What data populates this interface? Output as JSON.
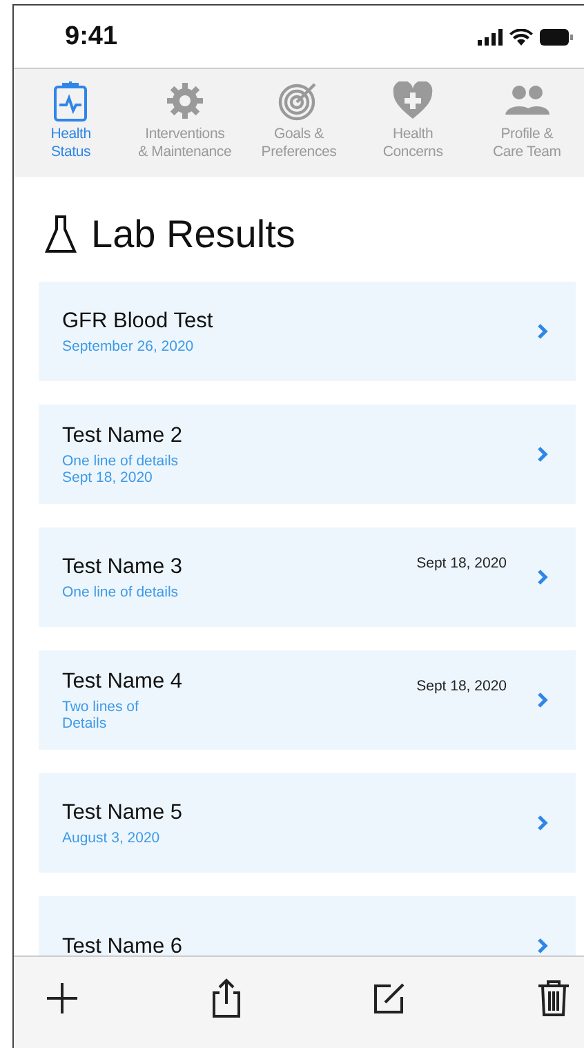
{
  "status_bar": {
    "time": "9:41"
  },
  "tabs": [
    {
      "kind": "clipboard",
      "label": [
        "Health",
        "Status"
      ],
      "selected": true
    },
    {
      "kind": "gear",
      "label": [
        "Interventions",
        "& Maintenance"
      ],
      "selected": false
    },
    {
      "kind": "target",
      "label": [
        "Goals &",
        "Preferences"
      ],
      "selected": false
    },
    {
      "kind": "heart",
      "label": [
        "Health",
        "Concerns"
      ],
      "selected": false
    },
    {
      "kind": "people",
      "label": [
        "Profile &",
        "Care Team"
      ],
      "selected": false
    }
  ],
  "page_title": "Lab Results",
  "lab_results": [
    {
      "name": "GFR Blood Test",
      "details": [
        "September 26, 2020"
      ]
    },
    {
      "name": "Test Name 2",
      "details": [
        "One line of details",
        "Sept 18, 2020"
      ]
    },
    {
      "name": "Test Name 3",
      "details": [
        "One line of details"
      ],
      "date": "Sept 18, 2020"
    },
    {
      "name": "Test Name 4",
      "details": [
        "Two lines of",
        "Details"
      ],
      "date": "Sept 18, 2020"
    },
    {
      "name": "Test Name 5",
      "details": [
        "August 3, 2020"
      ]
    },
    {
      "name": "Test Name 6"
    }
  ],
  "toolbar": [
    {
      "kind": "add"
    },
    {
      "kind": "share"
    },
    {
      "kind": "edit"
    },
    {
      "kind": "delete"
    }
  ]
}
